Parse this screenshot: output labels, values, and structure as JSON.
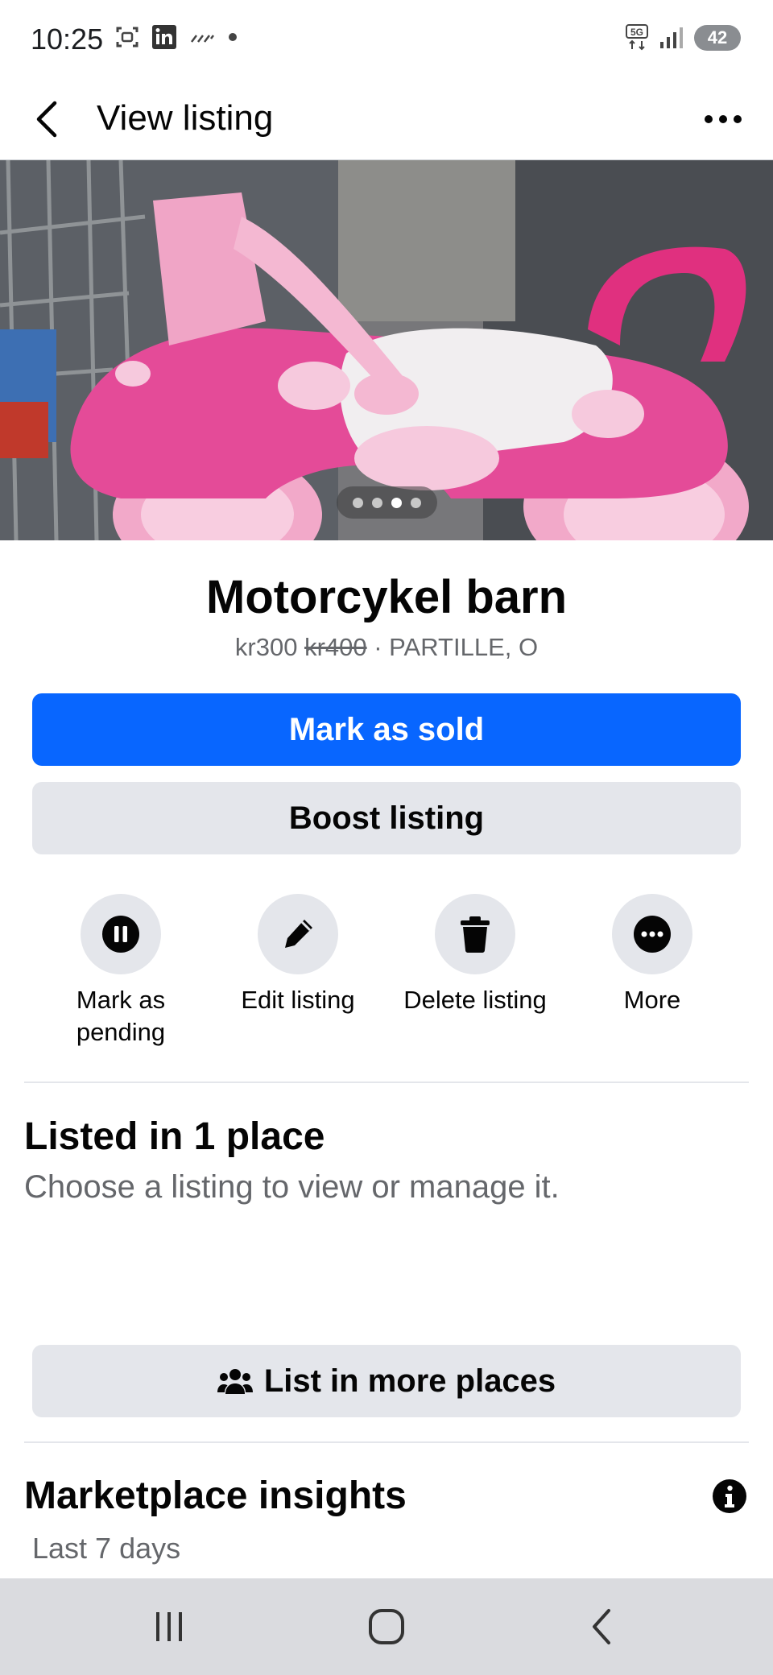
{
  "status_bar": {
    "time": "10:25",
    "battery": "42",
    "network": "5G"
  },
  "header": {
    "title": "View listing"
  },
  "listing": {
    "title": "Motorcykel barn",
    "price": "kr300",
    "original_price": "kr400",
    "location": " · PARTILLE, O",
    "photo_count": 4,
    "active_photo_index": 3
  },
  "buttons": {
    "mark_sold": "Mark as sold",
    "boost": "Boost listing",
    "list_more": "List in more places"
  },
  "actions": [
    {
      "label": "Mark as\npending",
      "icon": "pause-icon"
    },
    {
      "label": "Edit listing",
      "icon": "pencil-icon"
    },
    {
      "label": "Delete listing",
      "icon": "trash-icon"
    },
    {
      "label": "More",
      "icon": "more-icon"
    }
  ],
  "listed": {
    "title": "Listed in 1 place",
    "subtitle": "Choose a listing to view or manage it."
  },
  "insights": {
    "title": "Marketplace insights",
    "period": "Last 7 days"
  },
  "colors": {
    "primary": "#0866ff",
    "secondary_bg": "#e4e6eb",
    "muted_text": "#65676b"
  }
}
